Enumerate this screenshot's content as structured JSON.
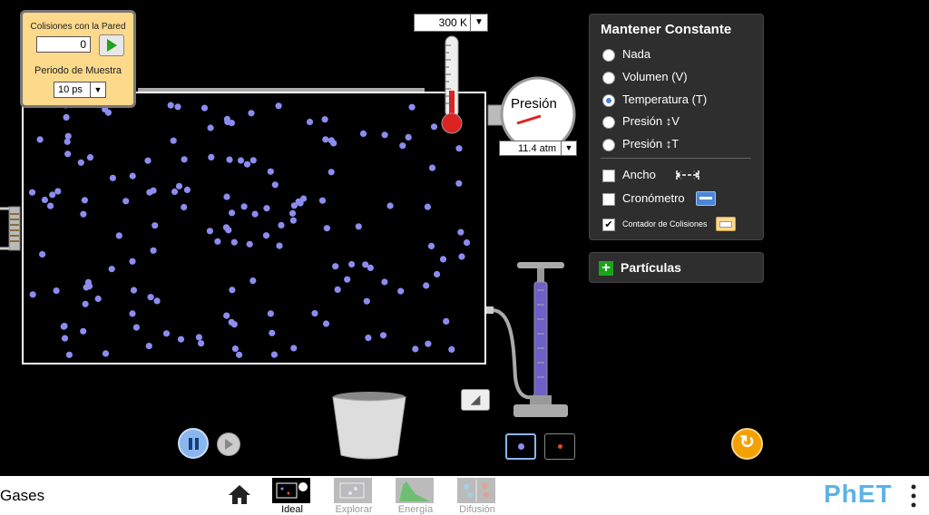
{
  "collision_counter": {
    "title": "Colisiones con la Pared",
    "count": "0",
    "sample_period_label": "Periodo de Muestra",
    "sample_period_value": "10 ps"
  },
  "thermometer": {
    "value": "300 K"
  },
  "gauge": {
    "label": "Presión",
    "value": "11.4 atm"
  },
  "hold_constant": {
    "title": "Mantener Constante",
    "options": [
      {
        "label": "Nada",
        "selected": false
      },
      {
        "label": "Volumen (V)",
        "selected": false
      },
      {
        "label": "Temperatura (T)",
        "selected": true
      },
      {
        "label": "Presión ↕V",
        "selected": false
      },
      {
        "label": "Presión ↕T",
        "selected": false
      }
    ]
  },
  "tools": {
    "width_label": "Ancho",
    "width_checked": false,
    "stopwatch_label": "Cronómetro",
    "stopwatch_checked": false,
    "collision_counter_label": "Contador de Colisiones",
    "collision_counter_checked": true
  },
  "particles_panel": {
    "label": "Partículas"
  },
  "nav": {
    "sim_title": "Gases",
    "screens": [
      {
        "label": "Ideal",
        "active": true
      },
      {
        "label": "Explorar",
        "active": false
      },
      {
        "label": "Energía",
        "active": false
      },
      {
        "label": "Difusión",
        "active": false
      }
    ],
    "brand": "PhET"
  },
  "colors": {
    "particle": "#8c8cf0",
    "panel": "#2e2e2e",
    "counter_bg": "#fcd98b",
    "reset": "#f2a100",
    "active_accent": "#8ab6f0"
  },
  "particle_count": 150
}
